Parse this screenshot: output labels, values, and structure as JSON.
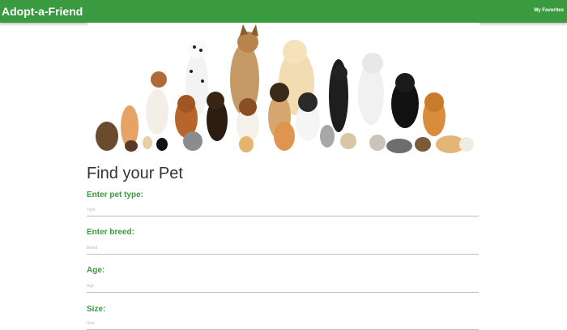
{
  "navbar": {
    "brand": "Adopt-a-Friend",
    "favorites_link": "My Favorites"
  },
  "hero": {
    "image": "group of dogs and cats"
  },
  "form": {
    "title": "Find your Pet",
    "fields": [
      {
        "label": "Enter pet type:",
        "placeholder": "Type"
      },
      {
        "label": "Enter breed:",
        "placeholder": "Breed"
      },
      {
        "label": "Age:",
        "placeholder": "Age"
      },
      {
        "label": "Size:",
        "placeholder": "Size"
      }
    ]
  },
  "colors": {
    "accent": "#3a9a3f",
    "label": "#3a9a3f",
    "heading": "#333333",
    "background": "#ffffff"
  }
}
